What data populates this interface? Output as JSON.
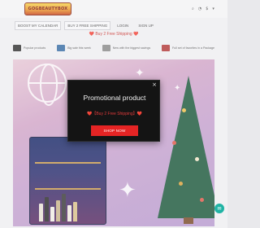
{
  "header": {
    "logo_text": "GOGBEAUTYBOX",
    "icons": [
      "search-icon",
      "user-icon",
      "cart-icon"
    ],
    "currency": "$"
  },
  "nav": {
    "items": [
      "BOOST MY CALENDAR",
      "BUY 2 FREE SHIPPING",
      "LOGIN",
      "SIGN UP"
    ]
  },
  "promo_line": "❤️ Buy 2 Free Shipping ❤️",
  "features": [
    {
      "icon": "tag-icon",
      "color": "#333333",
      "label": "Popular products"
    },
    {
      "icon": "truck-icon",
      "color": "#3a6ea5",
      "label": "Big sale this week"
    },
    {
      "icon": "bag-icon",
      "color": "#8a8a8a",
      "label": "New with the biggest savings"
    },
    {
      "icon": "gift-icon",
      "color": "#b33a3a",
      "label": "Full set of favorites in a Package"
    }
  ],
  "hero": {
    "image": "advent-calendar-christmas-tree-banner"
  },
  "modal": {
    "close_glyph": "×",
    "title": "Promotional product",
    "subtitle_pre": "❤️【",
    "subtitle_main": "Buy 2 Free Shipping",
    "subtitle_post": "】❤️",
    "button_label": "SHOP NOW"
  },
  "chat": {
    "icon": "chat-icon"
  },
  "colors": {
    "accent_red": "#e52424",
    "modal_bg": "#141414",
    "chat_teal": "#1fb3a4"
  }
}
